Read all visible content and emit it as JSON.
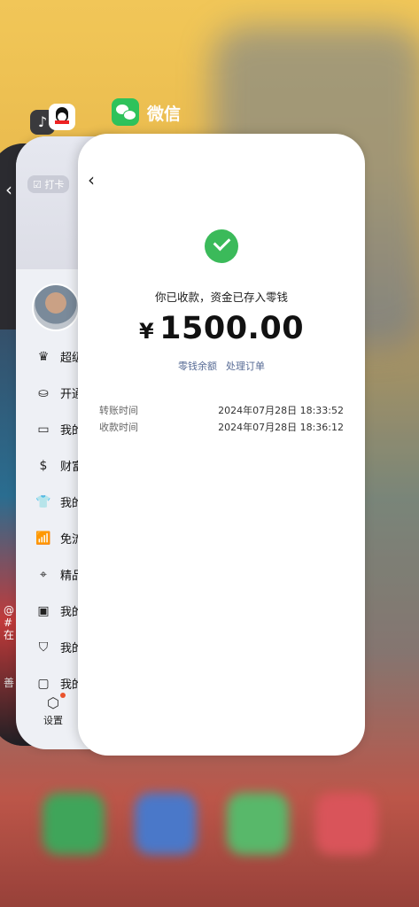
{
  "apps": {
    "wechat_name": "微信"
  },
  "qq": {
    "checkin_label": "打卡",
    "menu": [
      {
        "icon": "vip-crown-icon",
        "glyph": "♛",
        "label": "超级"
      },
      {
        "icon": "open-service-icon",
        "glyph": "⛀",
        "label": "开通"
      },
      {
        "icon": "wallet-icon",
        "glyph": "▭",
        "label": "我的"
      },
      {
        "icon": "money-bag-icon",
        "glyph": "$",
        "label": "财富"
      },
      {
        "icon": "shirt-icon",
        "glyph": "👕",
        "label": "我的"
      },
      {
        "icon": "wifi-signal-icon",
        "glyph": "📶",
        "label": "免流"
      },
      {
        "icon": "location-pin-icon",
        "glyph": "⌖",
        "label": "精品"
      },
      {
        "icon": "photo-album-icon",
        "glyph": "▣",
        "label": "我的"
      },
      {
        "icon": "bookmark-icon",
        "glyph": "⛉",
        "label": "我的"
      },
      {
        "icon": "folder-icon",
        "glyph": "▢",
        "label": "我的"
      }
    ],
    "settings_label": "设置"
  },
  "douyin": {
    "caption_line1": "@",
    "caption_line2": "#",
    "caption_line3": "在",
    "bottom_text": "善"
  },
  "wechat_receipt": {
    "status_message": "你已收款，资金已存入零钱",
    "currency_symbol": "¥",
    "amount": "1500.00",
    "link_balance": "零钱余额",
    "link_order": "处理订单",
    "transfer_time_label": "转账时间",
    "transfer_time_value": "2024年07月28日 18:33:52",
    "receive_time_label": "收款时间",
    "receive_time_value": "2024年07月28日 18:36:12"
  }
}
